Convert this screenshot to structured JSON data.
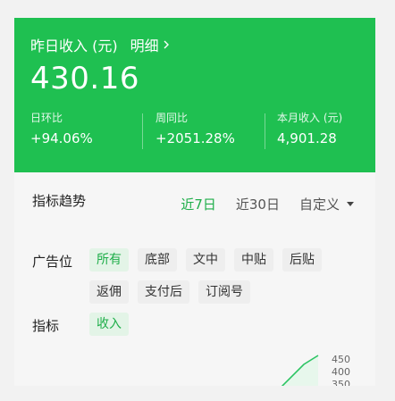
{
  "header": {
    "title": "昨日收入 (元)",
    "detail_label": "明细",
    "amount": "430.16",
    "stats": [
      {
        "label": "日环比",
        "value": "+94.06%"
      },
      {
        "label": "周同比",
        "value": "+2051.28%"
      },
      {
        "label": "本月收入 (元)",
        "value": "4,901.28"
      }
    ]
  },
  "trend": {
    "title": "指标趋势",
    "ranges": [
      {
        "label": "近7日",
        "active": true
      },
      {
        "label": "近30日",
        "active": false
      }
    ],
    "custom_label": "自定义"
  },
  "filters": {
    "ad_position_label": "广告位",
    "ad_positions": [
      "所有",
      "底部",
      "文中",
      "中贴",
      "后贴",
      "返佣",
      "支付后",
      "订阅号"
    ],
    "ad_position_selected": "所有",
    "metric_label": "指标",
    "metrics": [
      "收入"
    ],
    "metric_selected": "收入"
  },
  "chart_data": {
    "type": "line",
    "y_ticks": [
      450,
      400,
      350
    ]
  },
  "colors": {
    "brand_green": "#1fc051",
    "accent_green": "#1fae4a",
    "chip_active_bg": "#e3f4e7"
  },
  "icons": {
    "detail_chevron": "chevron-right-icon",
    "custom_dropdown": "caret-down-icon"
  }
}
